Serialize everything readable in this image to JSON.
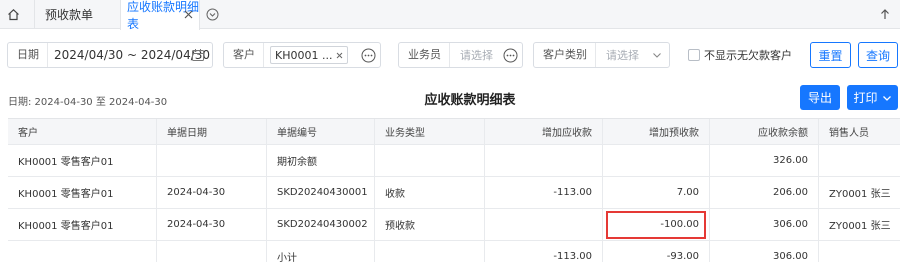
{
  "tabs": [
    {
      "label": "预收款单",
      "active": false
    },
    {
      "label": "应收账款明细表",
      "active": true
    }
  ],
  "filters": {
    "date_label": "日期",
    "date_value": "2024/04/30  ~  2024/04/30",
    "customer_label": "客户",
    "customer_chip": "KH0001 ...",
    "salesperson_label": "业务员",
    "salesperson_placeholder": "请选择",
    "customer_type_label": "客户类别",
    "customer_type_placeholder": "请选择",
    "hide_no_debt_label": "不显示无欠款客户",
    "reset_label": "重置",
    "query_label": "查询"
  },
  "report": {
    "date_range": "日期: 2024-04-30 至 2024-04-30",
    "title": "应收账款明细表",
    "export_label": "导出",
    "print_label": "打印"
  },
  "table": {
    "columns": [
      "客户",
      "单据日期",
      "单据编号",
      "业务类型",
      "增加应收款",
      "增加预收款",
      "应收款余额",
      "销售人员"
    ],
    "rows": [
      [
        "KH0001 零售客户01",
        "",
        "期初余额",
        "",
        "",
        "",
        "326.00",
        ""
      ],
      [
        "KH0001 零售客户01",
        "2024-04-30",
        "SKD20240430001",
        "收款",
        "-113.00",
        "7.00",
        "206.00",
        "ZY0001 张三"
      ],
      [
        "KH0001 零售客户01",
        "2024-04-30",
        "SKD20240430002",
        "预收款",
        "",
        "-100.00",
        "306.00",
        "ZY0001 张三"
      ],
      [
        "",
        "",
        "小计",
        "",
        "-113.00",
        "-93.00",
        "306.00",
        ""
      ]
    ]
  },
  "colors": {
    "accent": "#1677ff",
    "highlight": "#e53935"
  }
}
